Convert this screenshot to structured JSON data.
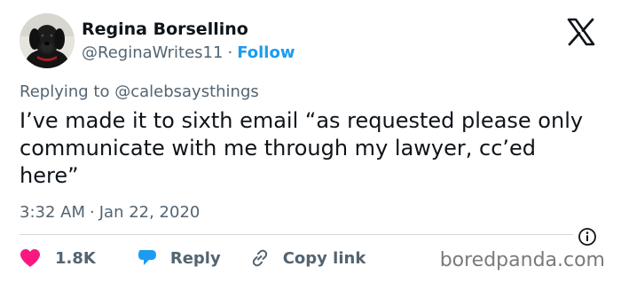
{
  "author": {
    "name": "Regina Borsellino",
    "handle": "@ReginaWrites11",
    "separator": "·",
    "follow_label": "Follow"
  },
  "reply_context": {
    "prefix": "Replying to",
    "mention": "@calebsaysthings"
  },
  "tweet": {
    "text": "I’ve made it to sixth email “as requested please only communicate with me through my lawyer, cc’ed here”",
    "time": "3:32 AM",
    "separator": "·",
    "date": "Jan 22, 2020"
  },
  "actions": {
    "like_count": "1.8K",
    "reply_label": "Reply",
    "copy_link_label": "Copy link"
  },
  "watermark": "boredpanda.com",
  "icons": {
    "brand": "x-logo-icon",
    "like": "heart-icon",
    "reply": "speech-bubble-icon",
    "copy_link": "link-icon",
    "info": "info-icon"
  },
  "colors": {
    "accent": "#1d9bf0",
    "like": "#f91880",
    "text": "#0f1419",
    "muted": "#536471",
    "divider": "#cfd9de"
  }
}
